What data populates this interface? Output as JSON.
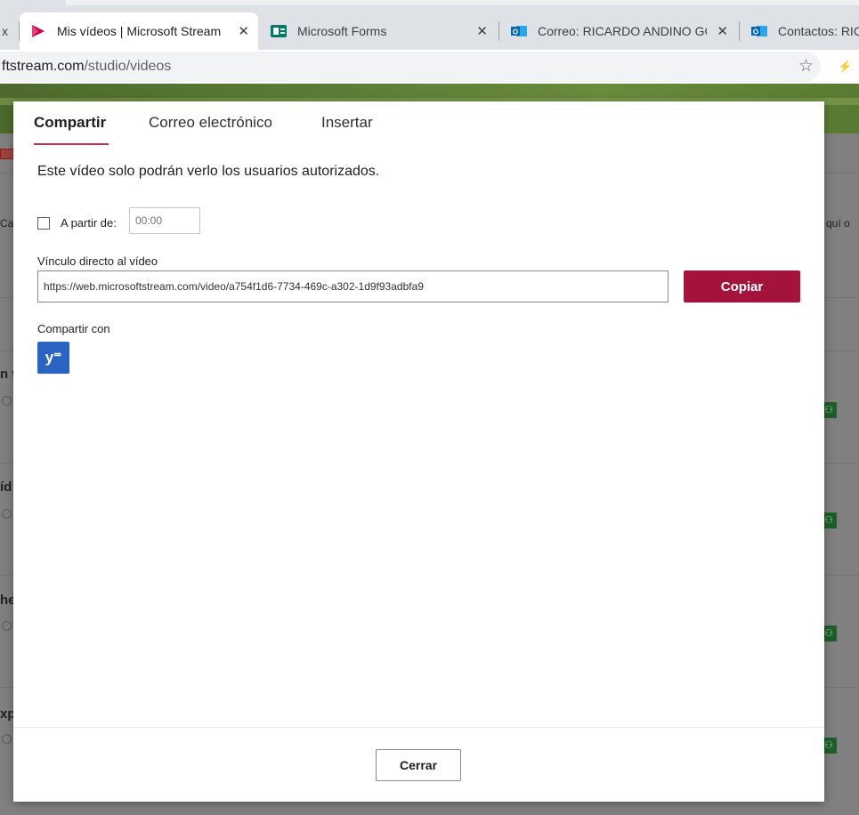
{
  "browser": {
    "tabs": [
      {
        "title": "x",
        "close": ""
      },
      {
        "title": "Mis vídeos | Microsoft Stream",
        "close": "✕",
        "favicon": "stream-icon"
      },
      {
        "title": "Microsoft Forms",
        "close": "✕",
        "favicon": "forms-icon"
      },
      {
        "title": "Correo: RICARDO ANDINO GO",
        "close": "✕",
        "favicon": "outlook-icon"
      },
      {
        "title": "Contactos: RIC",
        "close": "",
        "favicon": "outlook-icon"
      }
    ],
    "url_host": "ftstream.com",
    "url_path": "/studio/videos",
    "bookmark_icon": "star-icon"
  },
  "background_page": {
    "fragments": [
      "Ca",
      "quí o",
      "n t",
      "íd",
      "he",
      "xp"
    ],
    "colors": {
      "banner": "#5d7c38",
      "overlay": "#808080"
    }
  },
  "modal": {
    "tabs": [
      "Compartir",
      "Correo electrónico",
      "Insertar"
    ],
    "active_tab": "Compartir",
    "notice": "Este vídeo solo podrán verlo los usuarios autorizados.",
    "start_at_label": "A partir de:",
    "start_at_checked": false,
    "start_at_placeholder": "00:00",
    "link_label": "Vínculo directo al vídeo",
    "link_value": "https://web.microsoftstream.com/video/a754f1d6-7734-469c-a302-1d9f93adbfa9",
    "copy_label": "Copiar",
    "share_with_label": "Compartir con",
    "share_targets": [
      {
        "name": "Yammer",
        "glyph": "y⁼",
        "icon": "yammer-icon"
      }
    ],
    "close_label": "Cerrar",
    "colors": {
      "accent": "#a4133c",
      "tab_underline": "#c4314b",
      "yammer": "#2c64c4"
    }
  }
}
